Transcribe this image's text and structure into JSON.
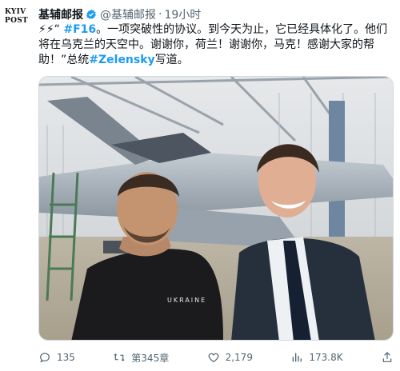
{
  "account": {
    "avatar_line1": "KYIV",
    "avatar_line2": "POST",
    "name": "基辅邮报",
    "handle": "@基辅邮报",
    "separator": "·",
    "time": "19小时"
  },
  "tweet": {
    "emoji": "⚡⚡",
    "quote_open": "“ ",
    "hashtag_f16": "#F16",
    "text_part1": "。一项突破性的协议。到今天为止，它已经具体化了。他们将在乌克兰的天空中。谢谢你，荷兰！谢谢你，马克！感谢大家的帮助！”总统",
    "hashtag_zelensky": "#Zelensky",
    "text_part2": "写道。"
  },
  "actions": {
    "reply_count": "135",
    "retweet_count": "第345章",
    "like_count": "2,179",
    "views_count": "173.8K"
  },
  "colors": {
    "link": "#1d9bf0",
    "verified": "#1d9bf0",
    "muted": "#536471"
  }
}
